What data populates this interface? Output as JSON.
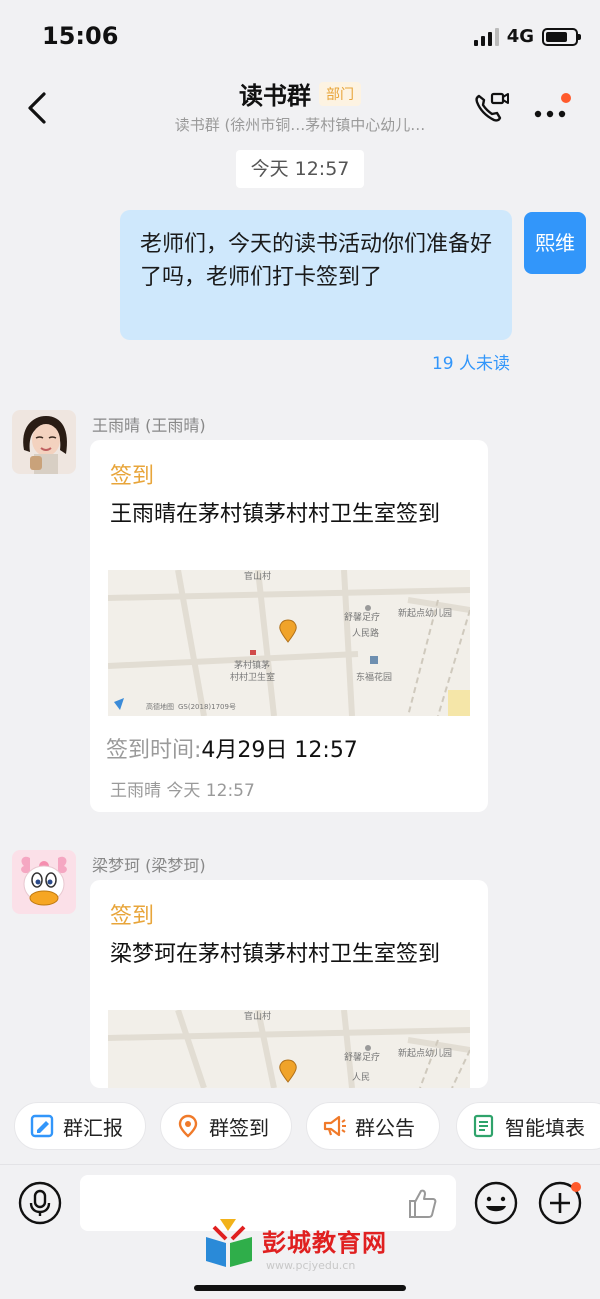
{
  "status_bar": {
    "time": "15:06",
    "network": "4G",
    "battery_level": 0.75
  },
  "nav": {
    "title": "读书群",
    "badge": "部门",
    "subtitle": "读书群 (徐州市铜…茅村镇中心幼儿…"
  },
  "chat": {
    "timestamp": "今天 12:57",
    "outgoing": {
      "text": "老师们，今天的读书活动你们准备好了吗，老师们打卡签到了",
      "avatar_label": "熙维",
      "unread": "19 人未读"
    },
    "messages": [
      {
        "sender": "王雨晴 (王雨晴)",
        "card_title": "签到",
        "card_text": "王雨晴在茅村镇茅村村卫生室签到",
        "time_label": "签到时间:",
        "time_value": "4月29日 12:57",
        "meta": "王雨晴   今天 12:57",
        "map": {
          "labels": [
            "官山村",
            "舒馨足疗",
            "新起点幼儿园",
            "茅村镇茅",
            "村村卫生室",
            "东福花园",
            "人民路",
            "高德地图",
            "GS(2018)1709号"
          ]
        }
      },
      {
        "sender": "梁梦珂 (梁梦珂)",
        "card_title": "签到",
        "card_text": "梁梦珂在茅村镇茅村村卫生室签到",
        "map": {
          "labels": [
            "官山村",
            "舒馨足疗",
            "新起点幼儿园",
            "人民"
          ]
        }
      }
    ]
  },
  "toolbar": {
    "items": [
      {
        "label": "群汇报",
        "icon": "report-icon",
        "color": "#3296fa"
      },
      {
        "label": "群签到",
        "icon": "location-icon",
        "color": "#f07a2a"
      },
      {
        "label": "群公告",
        "icon": "megaphone-icon",
        "color": "#f07a2a"
      },
      {
        "label": "智能填表",
        "icon": "form-icon",
        "color": "#2fa36b"
      }
    ]
  },
  "input": {
    "placeholder": ""
  },
  "watermark": {
    "text": "彭城教育网",
    "url": "www.pcjyedu.cn"
  },
  "colors": {
    "accent": "#3296fa",
    "checkin": "#e8a53a",
    "bubble": "#cfe8fc",
    "notify_dot": "#ff5a2c"
  }
}
